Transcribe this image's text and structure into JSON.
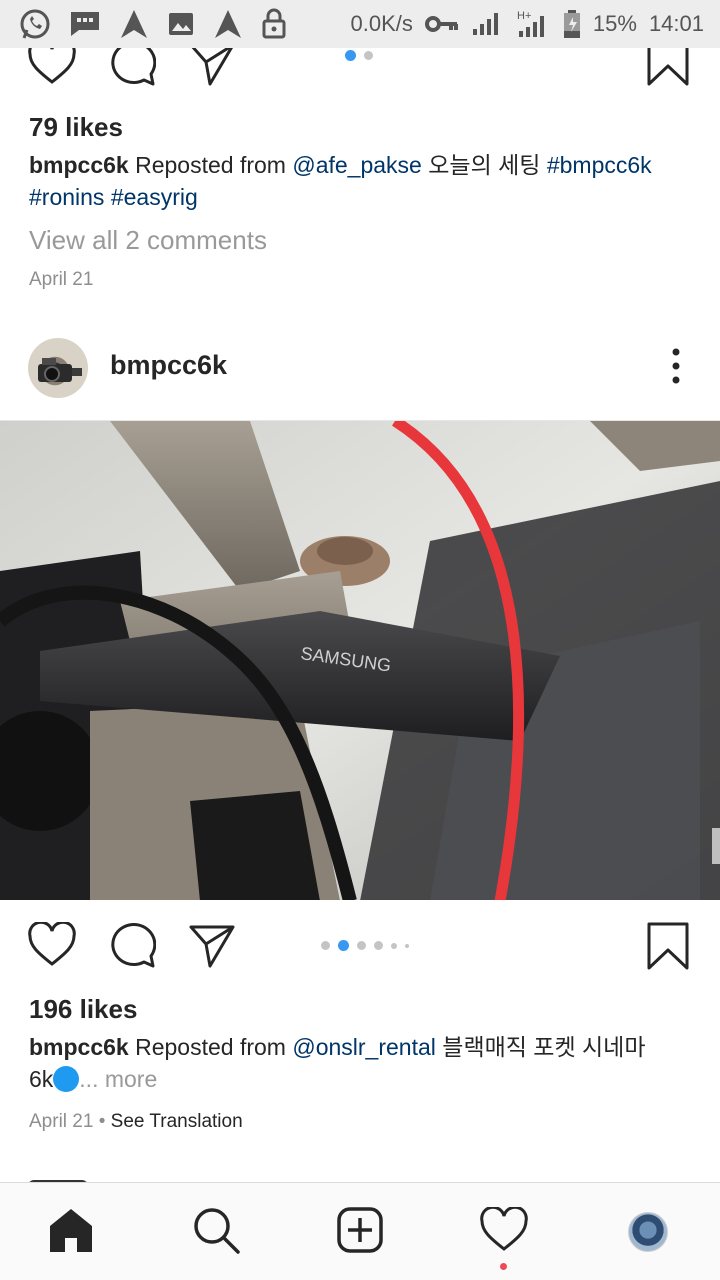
{
  "status_bar": {
    "network_speed": "0.0K/s",
    "battery_percent": "15%",
    "time": "14:01",
    "icons": [
      "whatsapp-icon",
      "message-icon",
      "navigation-icon",
      "image-icon",
      "navigation-icon",
      "lock-icon",
      "key-icon",
      "signal-icon",
      "hplus-signal-icon",
      "battery-icon"
    ]
  },
  "post_previous": {
    "likes": "79 likes",
    "caption_user": "bmpcc6k",
    "caption_text": "Reposted from",
    "caption_mention": "@afe_pakse",
    "caption_body": "오늘의 세팅",
    "caption_tags": [
      "#bmpcc6k",
      "#ronins",
      "#easyrig"
    ],
    "view_comments": "View all 2 comments",
    "date": "April 21",
    "carousel_count": 2,
    "carousel_active": 0
  },
  "post_current": {
    "username": "bmpcc6k",
    "likes": "196 likes",
    "caption_user": "bmpcc6k",
    "caption_text": "Reposted from",
    "caption_mention": "@onslr_rental",
    "caption_body_line1": "블랙매직 포켓 시네마",
    "caption_body_line2": "6k",
    "more_label": "... more",
    "date": "April 21",
    "separator": "•",
    "see_translation": "See Translation",
    "carousel_count": 6,
    "carousel_active": 1,
    "image_text": "SAMSUNG"
  },
  "bottom_nav": {
    "items": [
      "home-icon",
      "search-icon",
      "new-post-icon",
      "activity-icon",
      "profile-avatar"
    ],
    "active": "home-icon",
    "activity_has_notification": true
  },
  "colors": {
    "link": "#003569",
    "carousel_active": "#3897f0",
    "notification": "#ed4956",
    "text": "#262626",
    "muted": "#999999"
  }
}
